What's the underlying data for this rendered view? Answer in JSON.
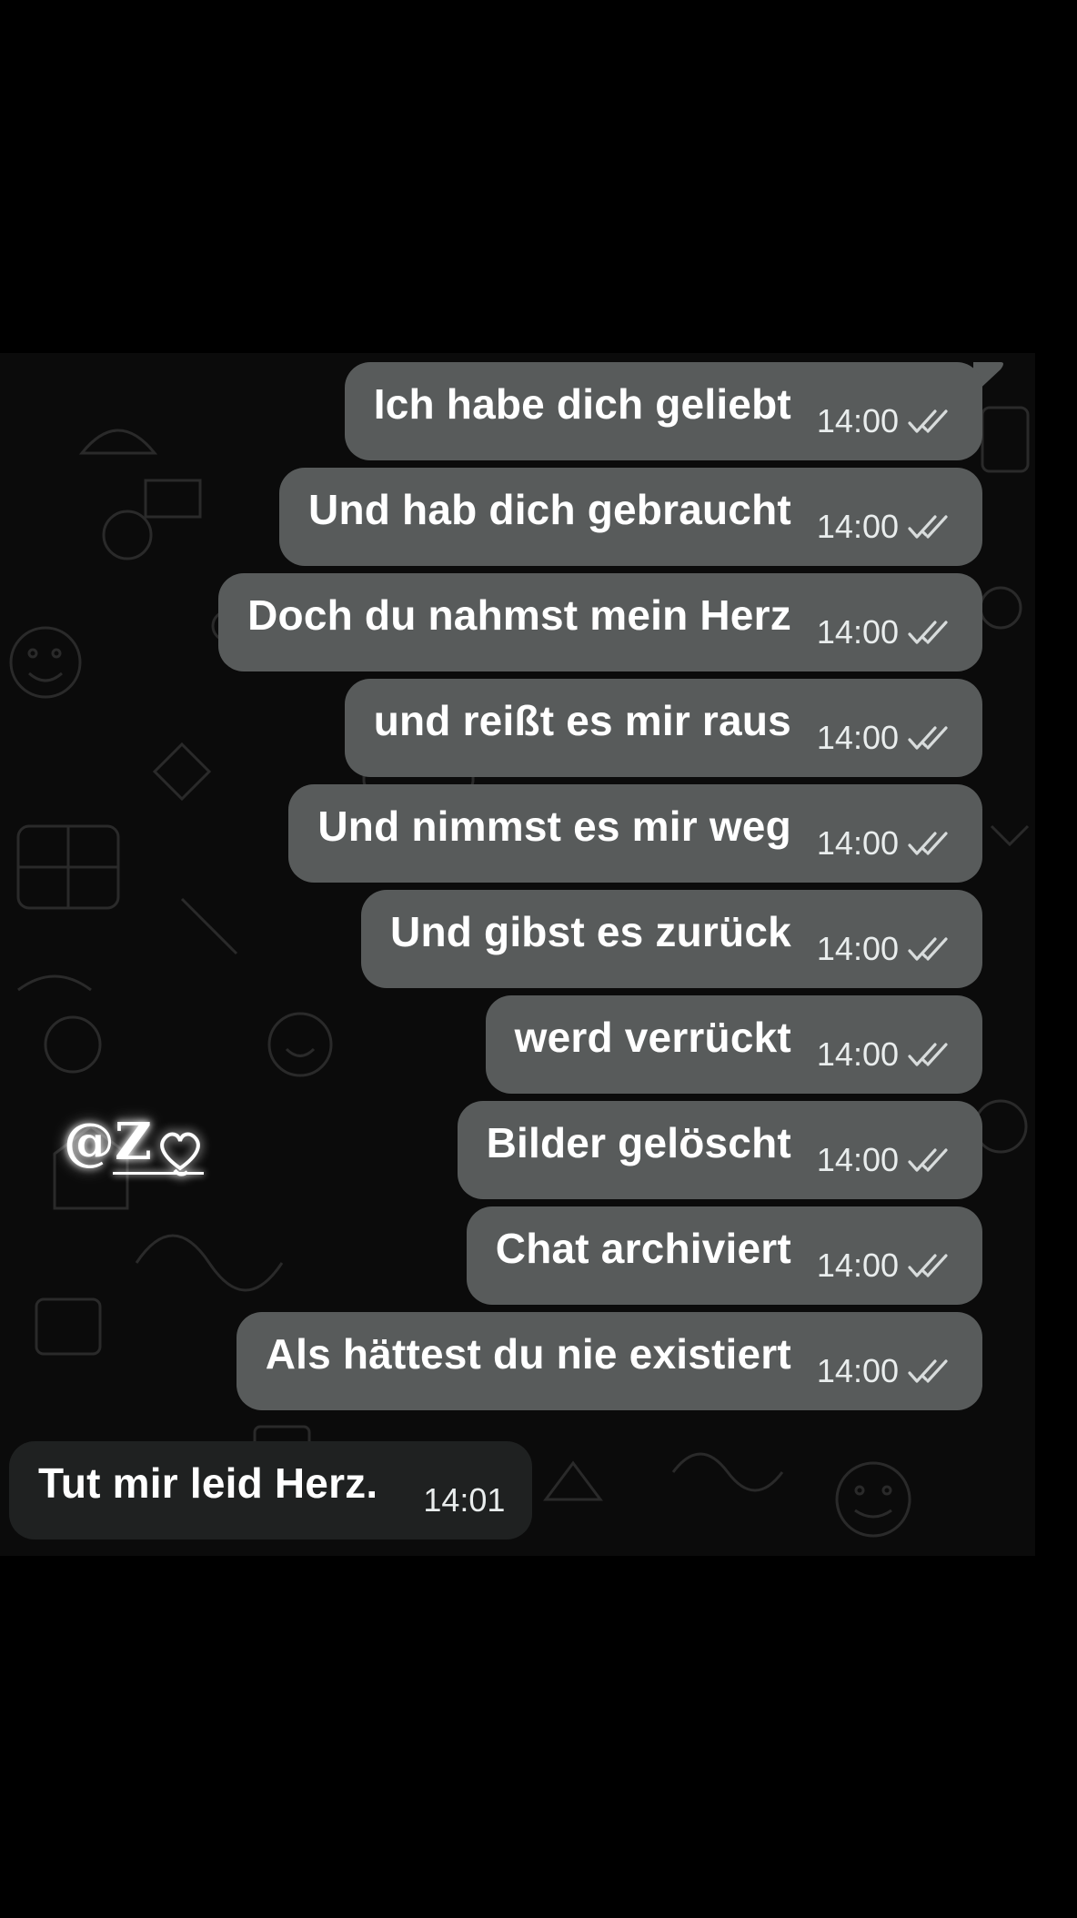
{
  "colors": {
    "outgoing_bubble": "#585b5b",
    "incoming_bubble": "#1f2121",
    "background": "#000000",
    "chat_background": "#0b0b0b",
    "text": "#ffffff"
  },
  "watermark": {
    "label": "@Z"
  },
  "messages": [
    {
      "text": "Ich habe dich geliebt",
      "time": "14:00",
      "direction": "outgoing",
      "status_icon": "double-check-icon"
    },
    {
      "text": "Und hab dich gebraucht",
      "time": "14:00",
      "direction": "outgoing",
      "status_icon": "double-check-icon"
    },
    {
      "text": "Doch du nahmst mein Herz",
      "time": "14:00",
      "direction": "outgoing",
      "status_icon": "double-check-icon"
    },
    {
      "text": "und reißt es mir raus",
      "time": "14:00",
      "direction": "outgoing",
      "status_icon": "double-check-icon"
    },
    {
      "text": "Und nimmst es mir weg",
      "time": "14:00",
      "direction": "outgoing",
      "status_icon": "double-check-icon"
    },
    {
      "text": "Und gibst es zurück",
      "time": "14:00",
      "direction": "outgoing",
      "status_icon": "double-check-icon"
    },
    {
      "text": "werd verrückt",
      "time": "14:00",
      "direction": "outgoing",
      "status_icon": "double-check-icon"
    },
    {
      "text": "Bilder gelöscht",
      "time": "14:00",
      "direction": "outgoing",
      "status_icon": "double-check-icon"
    },
    {
      "text": "Chat archiviert",
      "time": "14:00",
      "direction": "outgoing",
      "status_icon": "double-check-icon"
    },
    {
      "text": "Als hättest du nie existiert",
      "time": "14:00",
      "direction": "outgoing",
      "status_icon": "double-check-icon"
    },
    {
      "text": "Tut mir leid Herz.",
      "time": "14:01",
      "direction": "incoming"
    }
  ]
}
